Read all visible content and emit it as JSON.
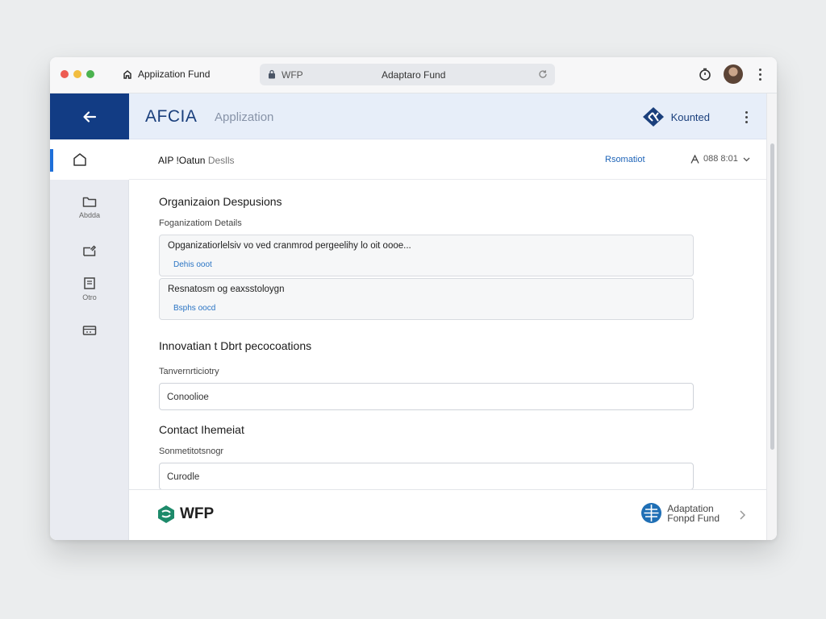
{
  "browser": {
    "tab_title": "Appiization Fund",
    "address_site": "WFP",
    "address_page": "Adaptaro Fund"
  },
  "app": {
    "brand": "AFCIA",
    "brand_sub": "Applization",
    "partner_name": "Kounted"
  },
  "sidebar": {
    "items": [
      {
        "icon": "home-icon",
        "label": ""
      },
      {
        "icon": "folder-icon",
        "label": "Abdda"
      },
      {
        "icon": "folder-edit-icon",
        "label": ""
      },
      {
        "icon": "document-icon",
        "label": "Otro"
      },
      {
        "icon": "wallet-icon",
        "label": ""
      }
    ]
  },
  "page_bar": {
    "title": "AIP !Oatun",
    "title_suffix": "Deslls",
    "action": "Rsomatiot",
    "user": "088 8:01"
  },
  "sections": {
    "org": {
      "title": "Organizaion Despusions",
      "label": "Foganizatiom Details",
      "cards": [
        {
          "text": "Opganizatiorlelsiv vo ved cranmrod pergeelihy lo oit oooe...",
          "link": "Dehis ooot"
        },
        {
          "text": "Resnatosm og eaxsstoloygn",
          "link": "Bsphs oocd"
        }
      ]
    },
    "innovation": {
      "title": "Innovatian t Dbrt  pecocoations",
      "label": "Tanvernrticiotry",
      "value": "Conoolioe"
    },
    "contact": {
      "title": "Contact Ihemeiat",
      "label": "Sonmetitotsnogr",
      "value": "Curodle"
    }
  },
  "footer": {
    "left_logo": "WFP",
    "right_logo_line1": "Adaptation",
    "right_logo_line2": "Fonpd Fund"
  },
  "colors": {
    "sidebar_header": "#123c84",
    "accent": "#1e6fd9",
    "app_header_bg": "#e7eef9",
    "wfp_green": "#1d8a6a",
    "af_blue": "#1f6fb5"
  }
}
